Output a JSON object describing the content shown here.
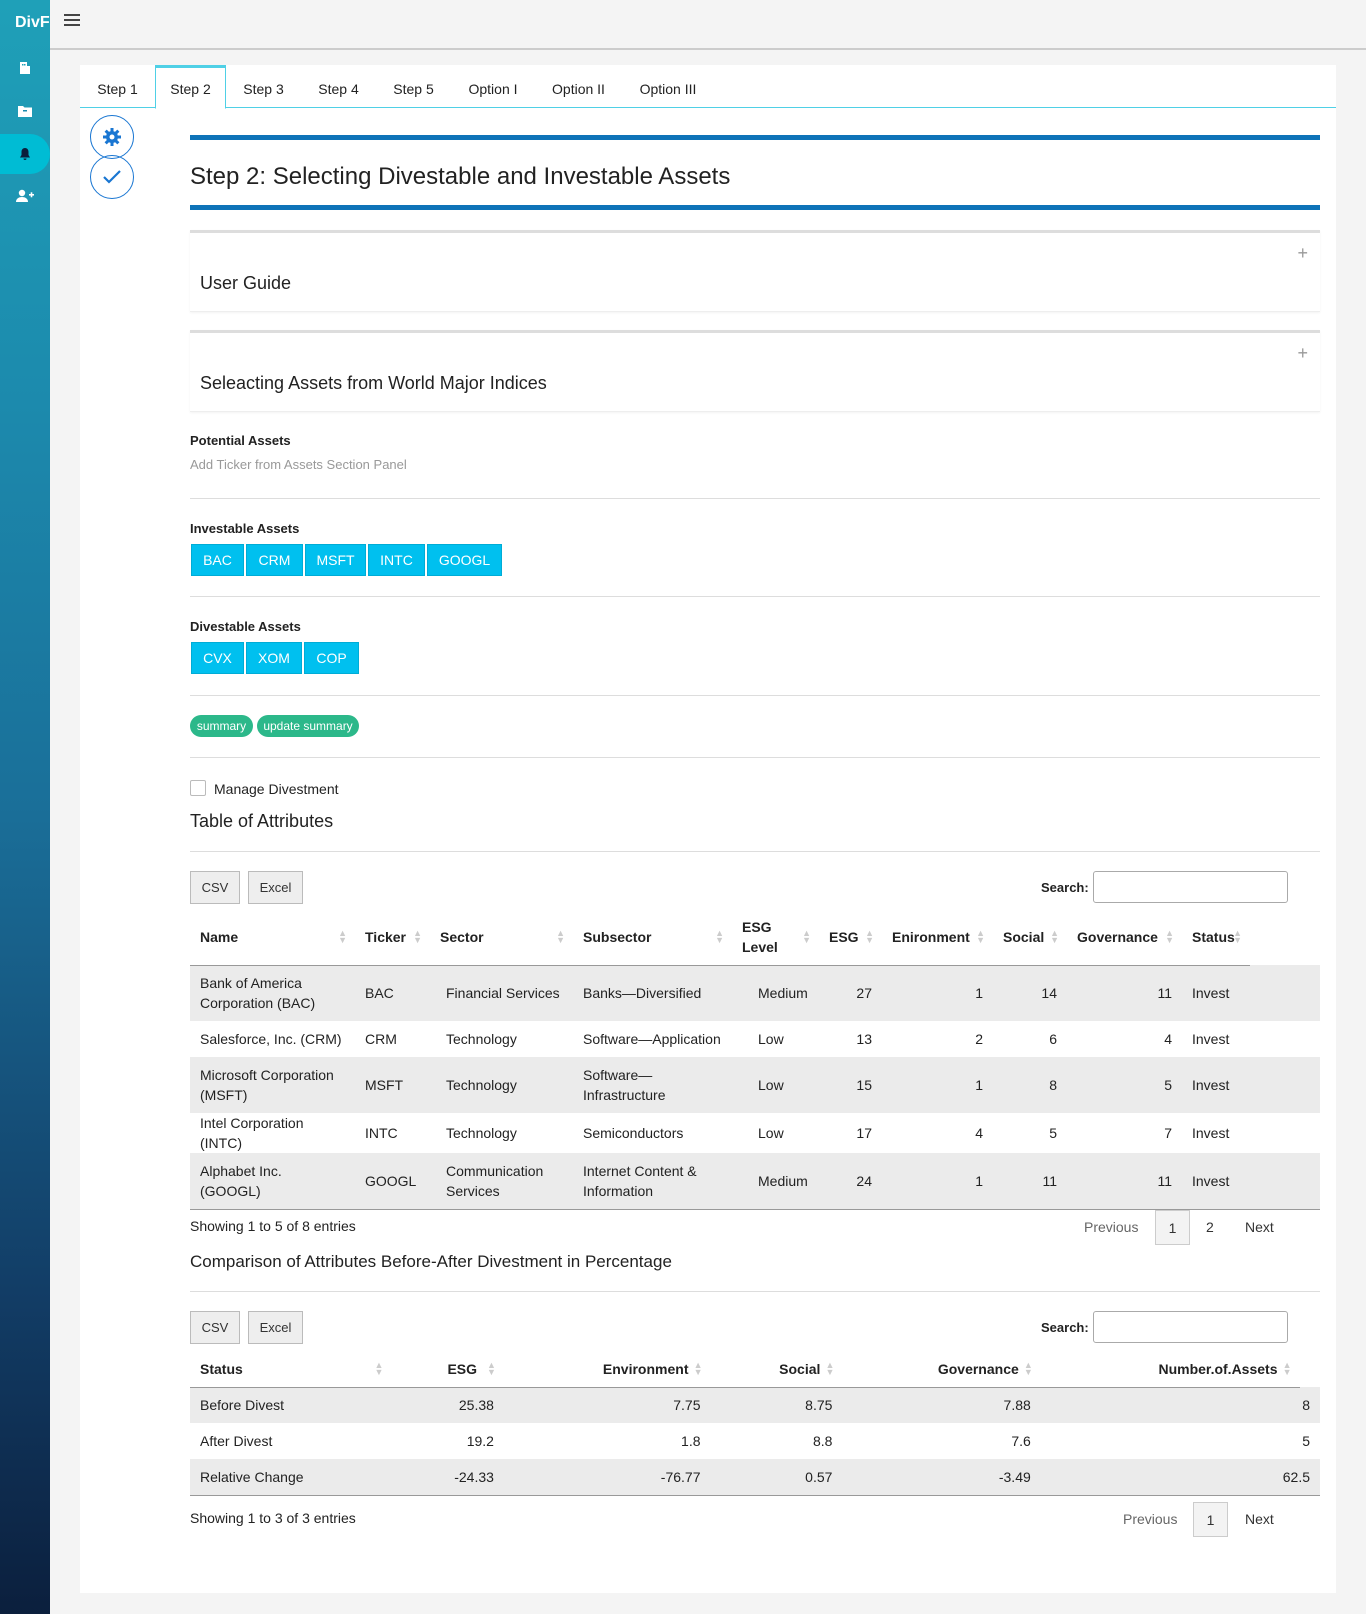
{
  "app": {
    "brand": "DivF"
  },
  "sidebar": {
    "items": [
      {
        "icon": "building-icon"
      },
      {
        "icon": "folder-icon"
      },
      {
        "icon": "bell-icon"
      },
      {
        "icon": "user-plus-icon"
      }
    ]
  },
  "tabs": [
    "Step 1",
    "Step 2",
    "Step 3",
    "Step 4",
    "Step 5",
    "Option I",
    "Option II",
    "Option III"
  ],
  "page": {
    "title": "Step 2: Selecting Divestable and Investable Assets"
  },
  "accordions": {
    "guide": "User Guide",
    "indices": "Seleacting Assets from World Major Indices"
  },
  "potential": {
    "label": "Potential Assets",
    "hint": "Add Ticker from Assets Section Panel"
  },
  "investable": {
    "label": "Investable Assets",
    "items": [
      "BAC",
      "CRM",
      "MSFT",
      "INTC",
      "GOOGL"
    ]
  },
  "divestable": {
    "label": "Divestable Assets",
    "items": [
      "CVX",
      "XOM",
      "COP"
    ]
  },
  "actions": {
    "summary": "summary",
    "update": "update summary"
  },
  "manage": {
    "label": "Manage Divestment"
  },
  "attributes": {
    "title": "Table of Attributes",
    "csv": "CSV",
    "excel": "Excel",
    "search_label": "Search:",
    "headers": [
      "Name",
      "Ticker",
      "Sector",
      "Subsector",
      "ESG Level",
      "ESG",
      "Enironment",
      "Social",
      "Governance",
      "Status"
    ],
    "rows": [
      [
        "Bank of America Corporation (BAC)",
        "BAC",
        "Financial Services",
        "Banks—Diversified",
        "Medium",
        "27",
        "1",
        "14",
        "11",
        "Invest"
      ],
      [
        "Salesforce, Inc. (CRM)",
        "CRM",
        "Technology",
        "Software—Application",
        "Low",
        "13",
        "2",
        "6",
        "4",
        "Invest"
      ],
      [
        "Microsoft Corporation (MSFT)",
        "MSFT",
        "Technology",
        "Software—Infrastructure",
        "Low",
        "15",
        "1",
        "8",
        "5",
        "Invest"
      ],
      [
        "Intel Corporation (INTC)",
        "INTC",
        "Technology",
        "Semiconductors",
        "Low",
        "17",
        "4",
        "5",
        "7",
        "Invest"
      ],
      [
        "Alphabet Inc. (GOOGL)",
        "GOOGL",
        "Communication Services",
        "Internet Content & Information",
        "Medium",
        "24",
        "1",
        "11",
        "11",
        "Invest"
      ]
    ],
    "info": "Showing 1 to 5 of 8 entries",
    "prev": "Previous",
    "next": "Next",
    "pages": [
      "1",
      "2"
    ]
  },
  "comparison": {
    "title": "Comparison of Attributes Before-After Divestment in Percentage",
    "csv": "CSV",
    "excel": "Excel",
    "search_label": "Search:",
    "headers": [
      "Status",
      "ESG",
      "Environment",
      "Social",
      "Governance",
      "Number.of.Assets"
    ],
    "rows": [
      [
        "Before Divest",
        "25.38",
        "7.75",
        "8.75",
        "7.88",
        "8"
      ],
      [
        "After Divest",
        "19.2",
        "1.8",
        "8.8",
        "7.6",
        "5"
      ],
      [
        "Relative Change",
        "-24.33",
        "-76.77",
        "0.57",
        "-3.49",
        "62.5"
      ]
    ],
    "info": "Showing 1 to 3 of 3 entries",
    "prev": "Previous",
    "next": "Next",
    "pages": [
      "1"
    ]
  }
}
